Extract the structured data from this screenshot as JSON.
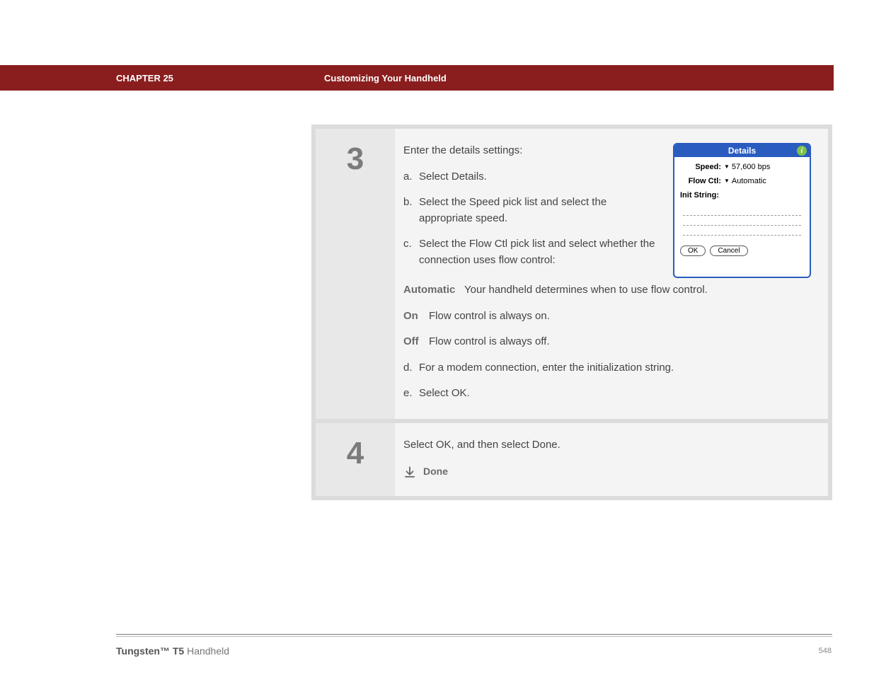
{
  "header": {
    "chapter": "CHAPTER 25",
    "title": "Customizing Your Handheld"
  },
  "step3": {
    "num": "3",
    "intro": "Enter the details settings:",
    "a_l": "a.",
    "a_t": "Select Details.",
    "b_l": "b.",
    "b_t": "Select the Speed pick list and select the appropriate speed.",
    "c_l": "c.",
    "c_t": "Select the Flow Ctl pick list and select whether the connection uses flow control:",
    "auto_label": "Automatic",
    "auto_text": "Your handheld determines when to use flow control.",
    "on_label": "On",
    "on_text": "Flow control is always on.",
    "off_label": "Off",
    "off_text": "Flow control is always off.",
    "d_l": "d.",
    "d_t": "For a modem connection, enter the initialization string.",
    "e_l": "e.",
    "e_t": "Select OK."
  },
  "dialog": {
    "title": "Details",
    "speed_label": "Speed:",
    "speed_value": "57,600 bps",
    "flow_label": "Flow Ctl:",
    "flow_value": "Automatic",
    "init_label": "Init String:",
    "ok": "OK",
    "cancel": "Cancel"
  },
  "step4": {
    "num": "4",
    "text": "Select OK, and then select Done.",
    "done": "Done"
  },
  "footer": {
    "product_bold": "Tungsten™ T5",
    "product_rest": " Handheld",
    "page": "548"
  }
}
